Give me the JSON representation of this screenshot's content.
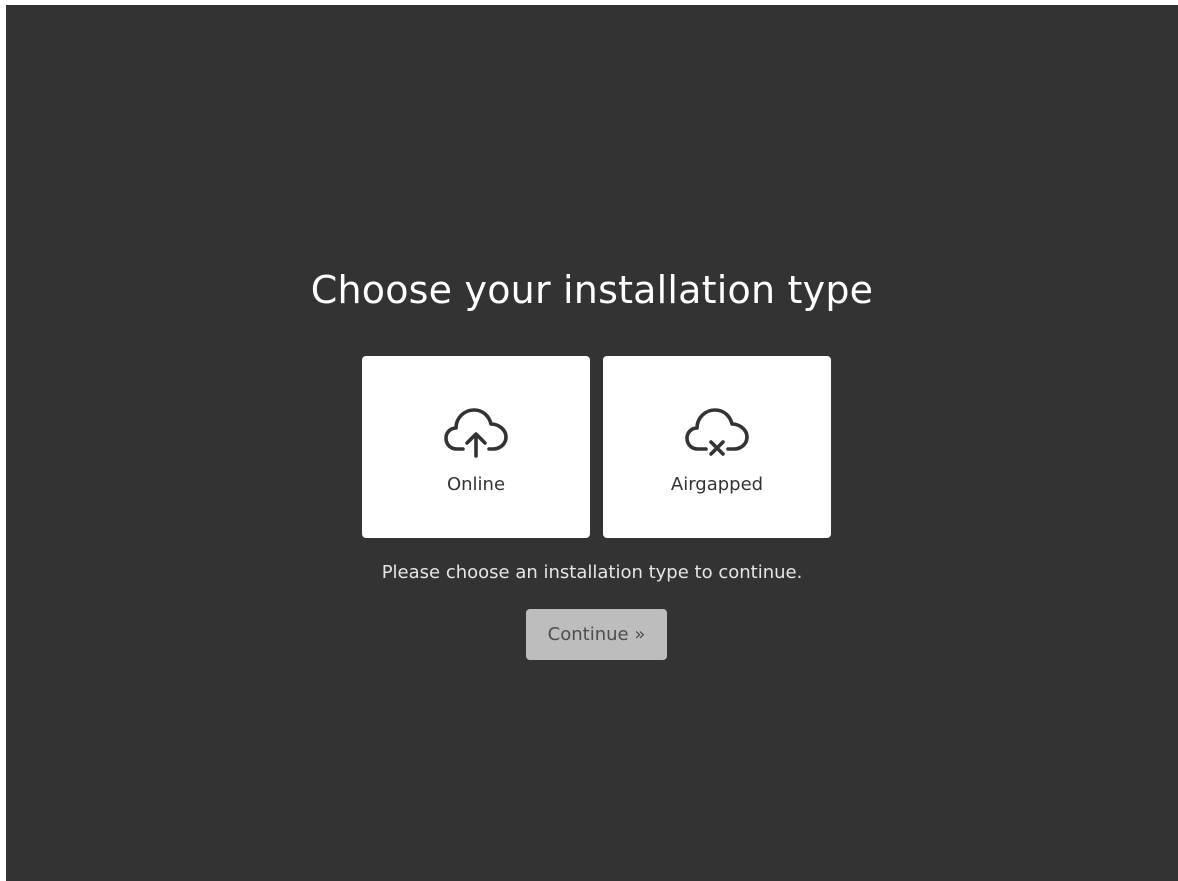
{
  "page": {
    "title": "Choose your installation type",
    "hint": "Please choose an installation type to continue."
  },
  "options": [
    {
      "label": "Online",
      "icon": "cloud-upload-icon"
    },
    {
      "label": "Airgapped",
      "icon": "cloud-off-icon"
    }
  ],
  "actions": {
    "continue_label": "Continue »",
    "continue_enabled": false
  },
  "colors": {
    "background": "#333333",
    "card": "#ffffff",
    "button_disabled": "#bdbdbd",
    "text_light": "#ffffff",
    "text_dark": "#333333"
  }
}
